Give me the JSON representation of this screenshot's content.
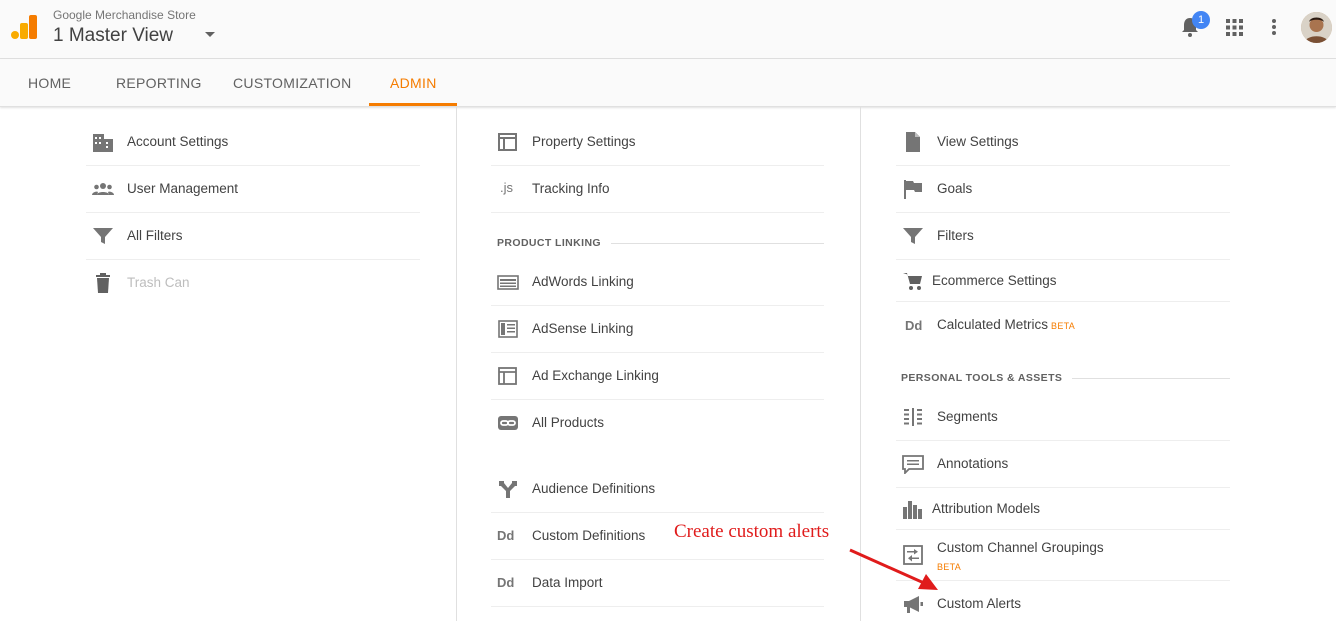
{
  "header": {
    "store_name": "Google Merchandise Store",
    "view_name": "1 Master View",
    "notifications_count": "1",
    "brand_color": "#f9ab00"
  },
  "tabs": [
    {
      "label": "HOME"
    },
    {
      "label": "REPORTING"
    },
    {
      "label": "CUSTOMIZATION"
    },
    {
      "label": "ADMIN",
      "active": true
    }
  ],
  "account_column": {
    "items": [
      {
        "label": "Account Settings",
        "icon": "building-icon"
      },
      {
        "label": "User Management",
        "icon": "users-icon"
      },
      {
        "label": "All Filters",
        "icon": "filter-icon"
      },
      {
        "label": "Trash Can",
        "icon": "trash-icon",
        "disabled": true
      }
    ]
  },
  "property_column": {
    "items": [
      {
        "label": "Property Settings",
        "icon": "window-icon"
      },
      {
        "label": "Tracking Info",
        "icon": "js-icon",
        "icon_text": ".js"
      }
    ],
    "section_title": "PRODUCT LINKING",
    "linking_items": [
      {
        "label": "AdWords Linking",
        "icon": "adwords-icon"
      },
      {
        "label": "AdSense Linking",
        "icon": "adsense-icon"
      },
      {
        "label": "Ad Exchange Linking",
        "icon": "ad-exchange-icon"
      },
      {
        "label": "All Products",
        "icon": "link-icon"
      }
    ],
    "other_items": [
      {
        "label": "Audience Definitions",
        "icon": "fork-icon"
      },
      {
        "label": "Custom Definitions",
        "icon": "dd-icon",
        "icon_text": "Dd"
      },
      {
        "label": "Data Import",
        "icon": "dd-icon",
        "icon_text": "Dd"
      }
    ]
  },
  "view_column": {
    "items": [
      {
        "label": "View Settings",
        "icon": "document-icon"
      },
      {
        "label": "Goals",
        "icon": "flag-icon"
      },
      {
        "label": "Filters",
        "icon": "filter-icon"
      },
      {
        "label": "Ecommerce Settings",
        "icon": "cart-icon"
      },
      {
        "label": "Calculated Metrics",
        "icon": "dd-icon",
        "icon_text": "Dd",
        "badge": "BETA"
      }
    ],
    "section_title": "PERSONAL TOOLS & ASSETS",
    "tools": [
      {
        "label": "Segments",
        "icon": "segments-icon"
      },
      {
        "label": "Annotations",
        "icon": "annotation-icon"
      },
      {
        "label": "Attribution Models",
        "icon": "bar-chart-icon"
      },
      {
        "label": "Custom Channel Groupings",
        "icon": "channel-icon",
        "badge": "BETA"
      },
      {
        "label": "Custom Alerts",
        "icon": "megaphone-icon"
      }
    ]
  },
  "annotation": {
    "text": "Create custom alerts",
    "color": "#e01b1b"
  }
}
